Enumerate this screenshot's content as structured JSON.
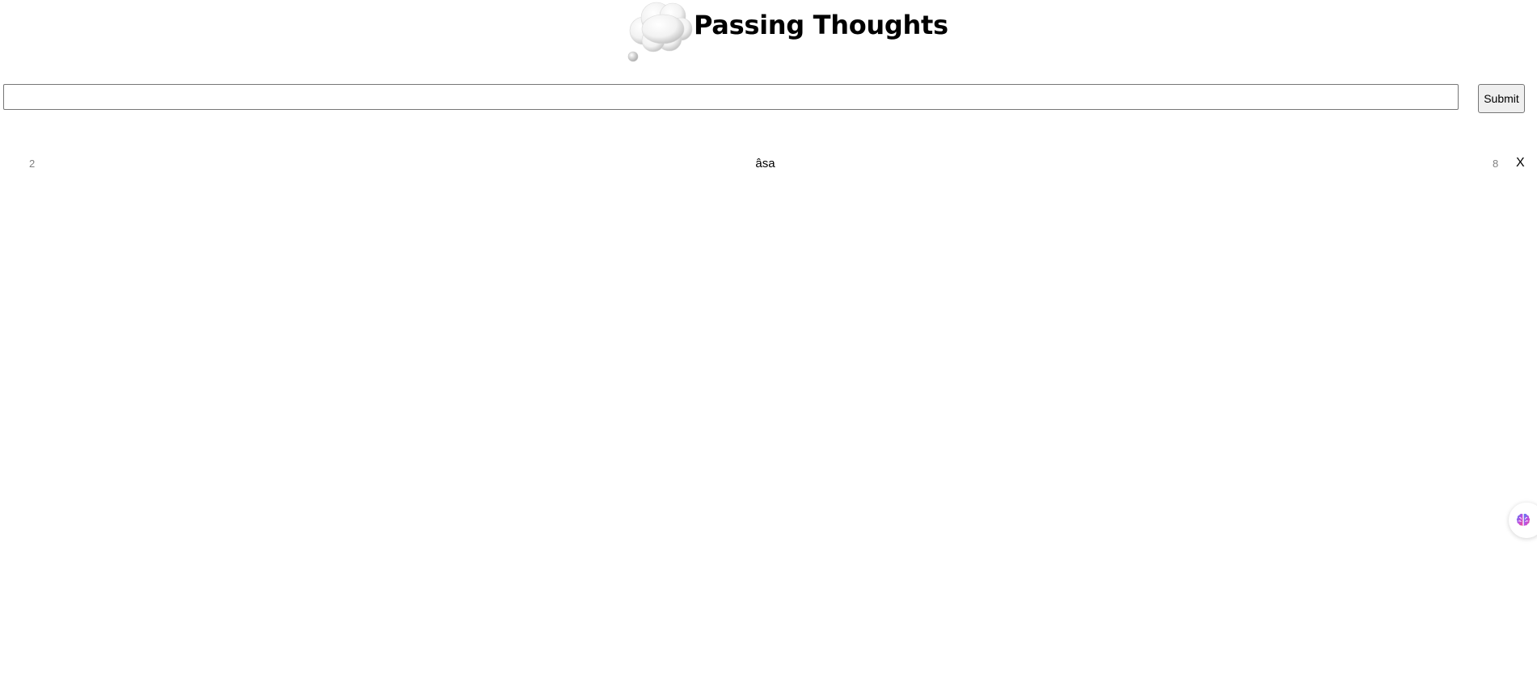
{
  "header": {
    "title": "Passing Thoughts",
    "logo_icon": "thought-cloud-icon"
  },
  "form": {
    "input_value": "",
    "input_placeholder": "",
    "submit_label": "Submit"
  },
  "thoughts": [
    {
      "left_count": "2",
      "text": "âsa",
      "right_count": "8",
      "delete_label": "X"
    }
  ],
  "widget": {
    "icon": "brain-icon",
    "colors": [
      "#4f7df3",
      "#c04ee0",
      "#f0508a"
    ]
  }
}
